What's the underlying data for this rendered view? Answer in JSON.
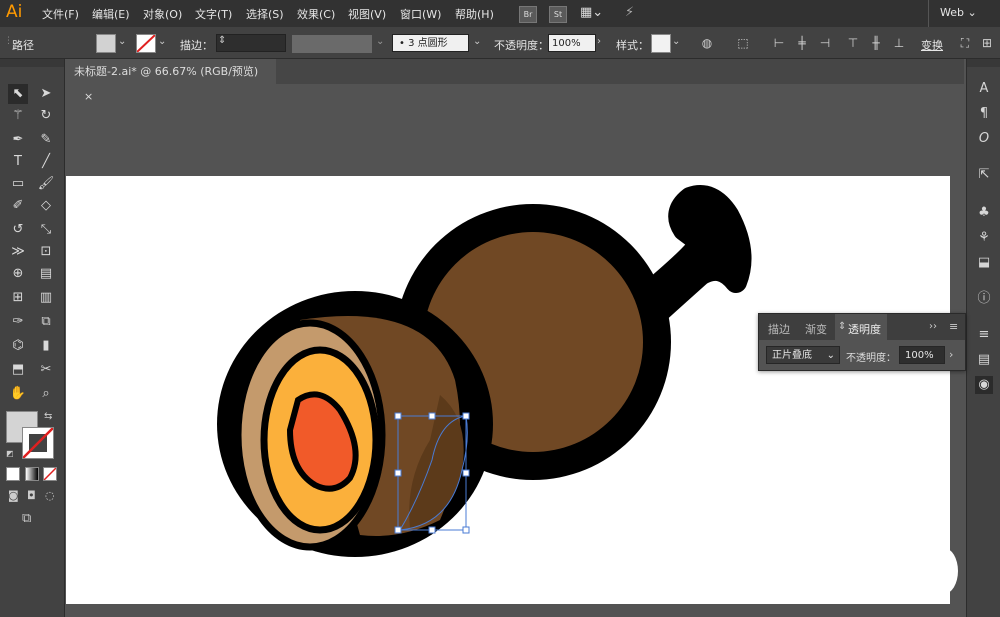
{
  "app": {
    "logo": "Ai",
    "workspace": "Web"
  },
  "menu": [
    "文件(F)",
    "编辑(E)",
    "对象(O)",
    "文字(T)",
    "选择(S)",
    "效果(C)",
    "视图(V)",
    "窗口(W)",
    "帮助(H)"
  ],
  "app_buttons": {
    "bridge": "Br",
    "stock": "St"
  },
  "control_bar": {
    "selection_label": "路径",
    "stroke_label": "描边：",
    "stroke_value": "",
    "brush_label": "3 点圆形",
    "opacity_label": "不透明度：",
    "opacity_value": "100%",
    "style_label": "样式：",
    "transform_label": "变换"
  },
  "document_tab": {
    "title": "未标题-2.ai* @ 66.67% (RGB/预览)",
    "close": "×"
  },
  "transparency_panel": {
    "tabs": [
      "描边",
      "渐变",
      "透明度"
    ],
    "active_tab": "透明度",
    "blend_mode": "正片叠底",
    "opacity_label": "不透明度：",
    "opacity_value": "100%"
  },
  "right_dock_icons": [
    "character-icon",
    "paragraph-icon",
    "opentype-icon",
    "export-icon",
    "symbols-icon",
    "libraries-icon",
    "asset-export-icon",
    "info-icon",
    "align-icon",
    "gradient-icon",
    "appearance-icon"
  ],
  "colors": {
    "brown": "#704824",
    "dark_brown": "#5c3a1a",
    "tan": "#c49a6c",
    "yolk_orange": "#fbb03b",
    "yolk_center": "#f15a29",
    "outline": "#000000",
    "selection": "#4a7bd4"
  }
}
